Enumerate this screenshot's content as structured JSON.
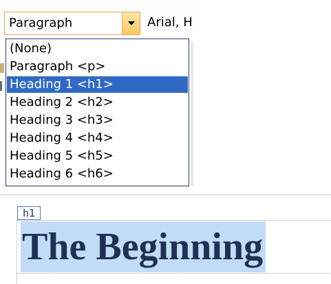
{
  "toolbar": {
    "style_select_value": "Paragraph",
    "font_select_value": "Arial, H"
  },
  "dropdown": {
    "options": [
      {
        "label": "(None)",
        "selected": false
      },
      {
        "label": "Paragraph <p>",
        "selected": false
      },
      {
        "label": "Heading 1 <h1>",
        "selected": true
      },
      {
        "label": "Heading 2 <h2>",
        "selected": false
      },
      {
        "label": "Heading 3 <h3>",
        "selected": false
      },
      {
        "label": "Heading 4 <h4>",
        "selected": false
      },
      {
        "label": "Heading 5 <h5>",
        "selected": false
      },
      {
        "label": "Heading 6 <h6>",
        "selected": false
      }
    ]
  },
  "editor": {
    "tag_badge": "h1",
    "heading_text": "The Beginning"
  },
  "colors": {
    "selection_highlight": "#316ac5",
    "heading_highlight": "#c2dcf7",
    "dropdown_button": "#ffc75e"
  },
  "icons": {
    "dropdown_arrow": "chevron-down-icon"
  }
}
